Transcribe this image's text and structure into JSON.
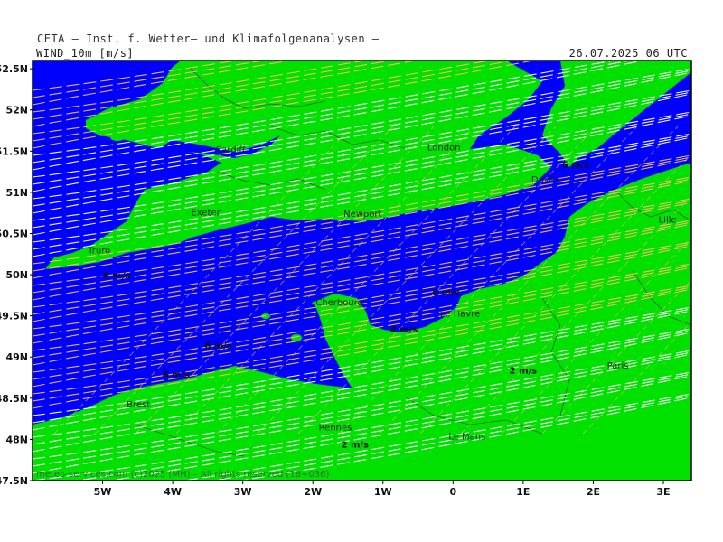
{
  "header": {
    "title": "CETA – Inst. f. Wetter– und Klimafolgenanalysen –",
    "variable": "WIND_10m [m/s]",
    "datetime": "26.07.2025 06 UTC"
  },
  "map": {
    "extent": {
      "lon": [
        -6.0,
        3.4
      ],
      "lat": [
        47.5,
        52.6
      ]
    },
    "lat_ticks": [
      "52.5N",
      "52N",
      "51.5N",
      "51N",
      "50.5N",
      "50N",
      "49.5N",
      "49N",
      "48.5N",
      "48N",
      "47.5N"
    ],
    "lon_ticks": [
      "5W",
      "4W",
      "3W",
      "2W",
      "1W",
      "0",
      "1E",
      "2E",
      "3E"
    ],
    "colors": {
      "sea": "#0000ff",
      "land": "#00e100",
      "streamline_land": "#ffffff",
      "streamline_sea": "#f2c060",
      "border": "#333333"
    },
    "cities": [
      {
        "name": "Cardiff",
        "lon": -3.18,
        "lat": 51.48
      },
      {
        "name": "London",
        "lon": -0.13,
        "lat": 51.51
      },
      {
        "name": "Dover",
        "lon": 1.31,
        "lat": 51.12
      },
      {
        "name": "Exeter",
        "lon": -3.53,
        "lat": 50.72
      },
      {
        "name": "Newport",
        "lon": -1.29,
        "lat": 50.7
      },
      {
        "name": "Truro",
        "lon": -5.05,
        "lat": 50.26
      },
      {
        "name": "Lille",
        "lon": 3.06,
        "lat": 50.63
      },
      {
        "name": "Cherbourg",
        "lon": -1.62,
        "lat": 49.63
      },
      {
        "name": "Le Havre",
        "lon": 0.1,
        "lat": 49.49
      },
      {
        "name": "Paris",
        "lon": 2.35,
        "lat": 48.86
      },
      {
        "name": "Brest",
        "lon": -4.49,
        "lat": 48.39
      },
      {
        "name": "Rennes",
        "lon": -1.68,
        "lat": 48.11
      },
      {
        "name": "Le Mans",
        "lon": 0.2,
        "lat": 48.0
      }
    ],
    "speed_labels": [
      {
        "text": "6 m/s",
        "lon": 1.75,
        "lat": 51.3
      },
      {
        "text": "6 m/s",
        "lon": -4.8,
        "lat": 49.95
      },
      {
        "text": "6 m/s",
        "lon": -0.1,
        "lat": 49.75
      },
      {
        "text": "4 m/s",
        "lon": -0.7,
        "lat": 49.3
      },
      {
        "text": "6 m/s",
        "lon": -3.35,
        "lat": 49.1
      },
      {
        "text": "2 m/s",
        "lon": 1.0,
        "lat": 48.8
      },
      {
        "text": "4 m/s",
        "lon": -3.95,
        "lat": 48.75
      },
      {
        "text": "2 m/s",
        "lon": -1.4,
        "lat": 47.9
      }
    ],
    "copyright": "meteo-services.com (c)2025 (MH) – All rights reserved (18+036)"
  }
}
